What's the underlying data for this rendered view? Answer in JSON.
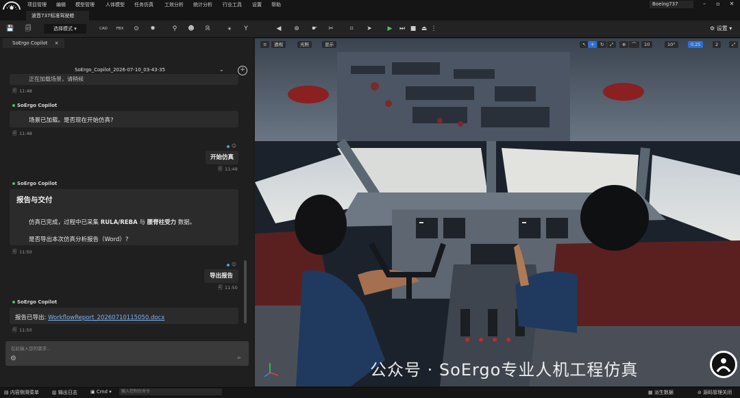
{
  "menu": [
    "项目管理",
    "编辑",
    "模型管理",
    "人体模型",
    "任务仿真",
    "工效分析",
    "统计分析",
    "行业工具",
    "设置",
    "帮助"
  ],
  "project_selector": "Boeing737",
  "window_controls": [
    "–",
    "▫",
    "✕"
  ],
  "document_tab": "波音737标准驾驶舱",
  "toolbar": {
    "mode_label": "选择模式",
    "icons": [
      "save-icon",
      "save-as-icon",
      "cad-icon",
      "fbx-icon",
      "sphere-icon",
      "sun-icon",
      "bulb-icon",
      "head-icon",
      "posture-icon",
      "walk-icon",
      "tool-icon",
      "camera-left-icon",
      "wheel-icon",
      "hand-icon",
      "cut-icon",
      "crop-icon",
      "send-icon",
      "play-icon",
      "step-icon",
      "stop-icon",
      "eject-icon",
      "more-icon"
    ],
    "cad_label": "CAD",
    "fbx_label": "FBX",
    "settings_label": "设置"
  },
  "panel": {
    "tab_label": "SoErgo Copilot",
    "session_title": "SoErgo_Copilot_2026-07-10_03-43-35",
    "partial_text": "正在加载场景，请稍候",
    "messages": [
      {
        "time": "11:48"
      },
      {
        "sender": "SoErgo Copilot",
        "text": "场景已加载。是否现在开始仿真?",
        "time": "11:48"
      },
      {
        "user_text": "开始仿真",
        "time": "11:49"
      },
      {
        "sender": "SoErgo Copilot",
        "heading": "报告与交付",
        "line1_prefix": "仿真已完成，过程中已采集 ",
        "line1_bold1": "RULA/REBA",
        "line1_mid": " 与 ",
        "line1_bold2": "腰脊柱受力",
        "line1_suffix": " 数据。",
        "line2": "是否导出本次仿真分析报告（Word）?",
        "time": "11:50"
      },
      {
        "user_text": "导出报告",
        "time": "11:50"
      },
      {
        "sender": "SoErgo Copilot",
        "prefix": "报告已导出: ",
        "link": "WorkflowReport_20260710115050.docx",
        "time": "11:50"
      }
    ],
    "input_placeholder": "在此输入您的需求..."
  },
  "viewport": {
    "toolbar_left": [
      "透视",
      "光照",
      "显示"
    ],
    "toolbar_right": [
      "10",
      "10°",
      "0.25",
      "2"
    ]
  },
  "statusbar": {
    "content_browser": "内容侧滑菜单",
    "output_log": "输出日志",
    "cmd": "Cmd",
    "cmd_placeholder": "输入控制台命令",
    "derived_data": "派生数据",
    "source_control": "源码管理关闭"
  },
  "watermark": "公众号 · SoErgo专业人机工程仿真"
}
